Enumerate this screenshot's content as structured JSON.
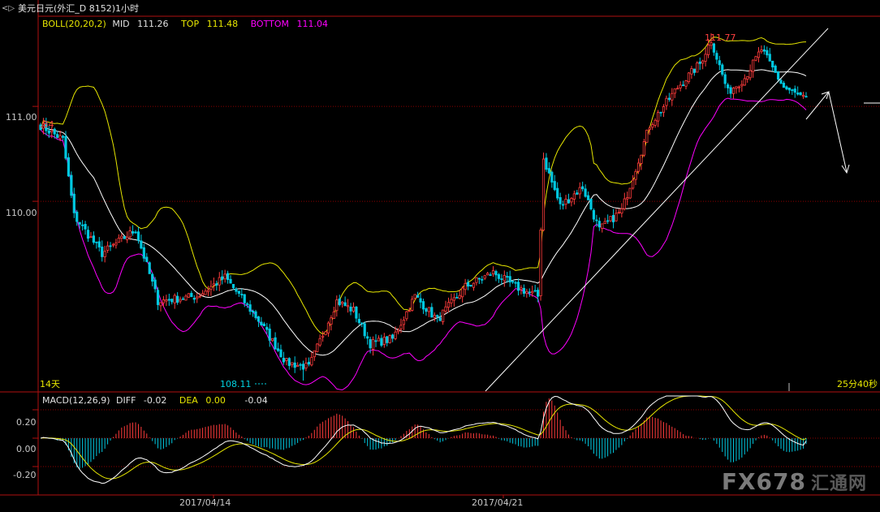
{
  "header": {
    "nav_arrows": "<▷",
    "title": "美元日元(外汇_D 8152)1小时"
  },
  "boll": {
    "name": "BOLL(20,20,2)",
    "mid_label": "MID",
    "mid_value": "111.26",
    "top_label": "TOP",
    "top_value": "111.48",
    "bottom_label": "BOTTOM",
    "bottom_value": "111.04"
  },
  "macd": {
    "name": "MACD(12,26,9)",
    "diff_label": "DIFF",
    "diff_value": "-0.02",
    "dea_label": "DEA",
    "dea_value": "0.00",
    "macd_value": "-0.04"
  },
  "price_axis": {
    "ticks": [
      "111.00",
      "110.00"
    ]
  },
  "macd_axis": {
    "ticks": [
      "0.20",
      "0.00",
      "-0.20"
    ]
  },
  "time_axis": {
    "ticks": [
      "2017/04/14",
      "2017/04/21"
    ]
  },
  "annotations": {
    "high": "111.77",
    "low": "108.11",
    "left_partial": ".84",
    "period": "14天",
    "countdown": "25分40秒"
  },
  "watermark": {
    "brand": "FX678",
    "cn": "汇通网"
  },
  "colors": {
    "up": "#ff3b3b",
    "down": "#00c8e0",
    "mid": "#ffffff",
    "top": "#e6e600",
    "bottom": "#ff00ff",
    "grid": "#8b0000",
    "axis_text": "#c8c8c8",
    "diff": "#ffffff",
    "dea": "#e6e600"
  },
  "chart_data": [
    {
      "type": "candlestick",
      "title": "美元日元(外汇_D 8152)1小时",
      "ylim": [
        108.0,
        111.95
      ],
      "y_ticks": [
        111.0,
        110.0
      ],
      "x_ticks": [
        "2017/04/14",
        "2017/04/21"
      ],
      "grid": "horizontal dotted",
      "segments": [
        [
          0,
          110.8
        ],
        [
          8,
          110.65
        ],
        [
          12,
          109.85
        ],
        [
          22,
          109.45
        ],
        [
          34,
          109.7
        ],
        [
          42,
          108.95
        ],
        [
          56,
          109.0
        ],
        [
          66,
          109.2
        ],
        [
          78,
          108.75
        ],
        [
          88,
          108.3
        ],
        [
          96,
          108.25
        ],
        [
          106,
          108.95
        ],
        [
          112,
          108.85
        ],
        [
          118,
          108.5
        ],
        [
          126,
          108.55
        ],
        [
          134,
          109.0
        ],
        [
          142,
          108.75
        ],
        [
          152,
          109.1
        ],
        [
          162,
          109.25
        ],
        [
          170,
          109.1
        ],
        [
          178,
          109.0
        ],
        [
          180,
          110.45
        ],
        [
          186,
          109.95
        ],
        [
          194,
          110.15
        ],
        [
          200,
          109.7
        ],
        [
          208,
          109.9
        ],
        [
          218,
          110.8
        ],
        [
          228,
          111.2
        ],
        [
          236,
          111.45
        ],
        [
          240,
          111.7
        ],
        [
          246,
          111.15
        ],
        [
          252,
          111.3
        ],
        [
          258,
          111.6
        ],
        [
          266,
          111.2
        ],
        [
          275,
          111.05
        ]
      ],
      "candles": 275,
      "high": 111.77,
      "low": 108.11,
      "bollinger": {
        "period": 20,
        "k": 2,
        "mid": 111.26,
        "top": 111.48,
        "bottom": 111.04
      }
    },
    {
      "type": "bar+line",
      "title": "MACD(12,26,9)",
      "ylim": [
        -0.4,
        0.32
      ],
      "y_ticks": [
        0.2,
        0.0,
        -0.2
      ],
      "diff": -0.02,
      "dea": 0.0,
      "macd": -0.04
    }
  ]
}
